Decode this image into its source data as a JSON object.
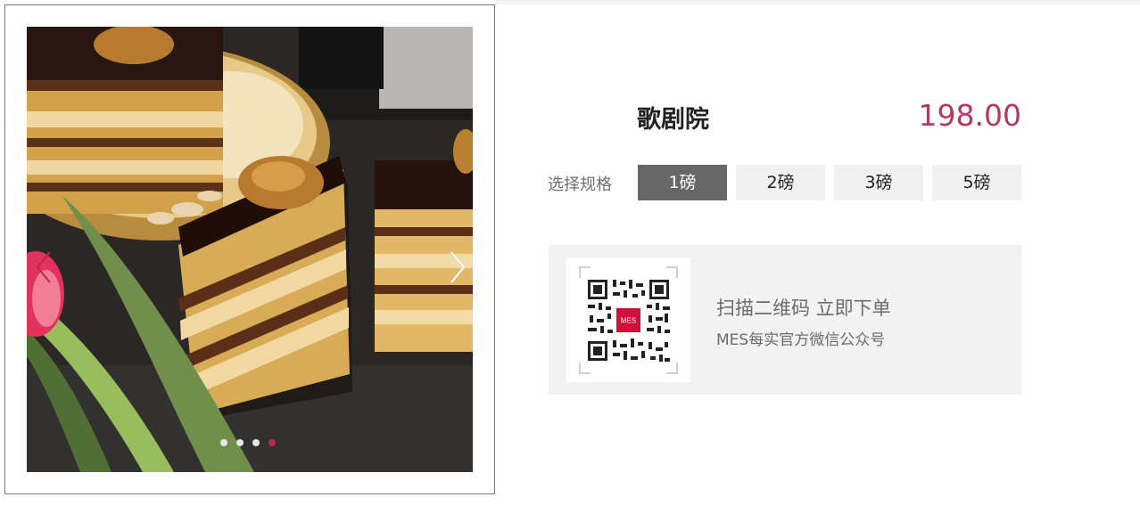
{
  "product": {
    "title": "歌剧院",
    "price": "198.00"
  },
  "specs": {
    "label": "选择规格",
    "options": [
      "1磅",
      "2磅",
      "3磅",
      "5磅"
    ],
    "selected_index": 0
  },
  "gallery": {
    "image": "chocolate-layer-cake-photo",
    "slide_count": 4,
    "active_slide_index": 3,
    "prev_icon": "chevron-left-icon",
    "next_icon": "chevron-right-icon"
  },
  "qr": {
    "scan_text": "扫描二维码 立即下单",
    "account_text": "MES每实官方微信公众号",
    "logo_text": "MES"
  },
  "colors": {
    "price": "#b43a5c",
    "selected_spec_bg": "#676767",
    "unselected_spec_bg": "#f1f1f1",
    "active_dot": "#c4244a",
    "prev_arrow": "#c4244a",
    "next_arrow": "#ffffff",
    "qr_logo": "#d0103a"
  }
}
